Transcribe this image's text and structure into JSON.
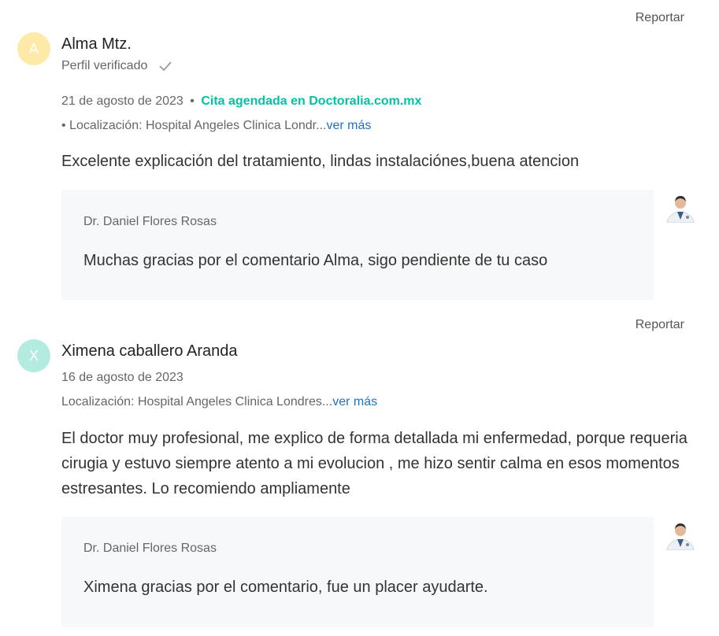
{
  "reviews": [
    {
      "report_label": "Reportar",
      "avatar_letter": "A",
      "name": "Alma Mtz.",
      "verified_label": "Perfil verificado",
      "date": "21 de agosto de 2023",
      "separator": "•",
      "booking_label": "Cita agendada en Doctoralia.com.mx",
      "location_prefix": "• Localización: Hospital Angeles Clinica Londr...",
      "more_label": "ver más",
      "text": "Excelente explicación del tratamiento, lindas instalaciónes,buena atencion",
      "reply": {
        "doctor": "Dr. Daniel Flores Rosas",
        "text": "Muchas gracias por el comentario Alma, sigo pendiente de tu caso"
      }
    },
    {
      "report_label": "Reportar",
      "avatar_letter": "X",
      "name": "Ximena caballero Aranda",
      "date": "16 de agosto de 2023",
      "location_prefix": "Localización: Hospital Angeles Clinica Londres...",
      "more_label": "ver más",
      "text": "El doctor muy profesional, me explico de forma detallada mi enfermedad, porque requeria cirugia y estuvo siempre atento a mi evolucion , me hizo sentir calma en esos momentos estresantes. Lo recomiendo ampliamente",
      "reply": {
        "doctor": "Dr. Daniel Flores Rosas",
        "text": "Ximena gracias por el comentario, fue un placer ayudarte."
      }
    }
  ],
  "icons": {
    "verified": "check-icon",
    "doctor": "doctor-photo-icon"
  },
  "colors": {
    "accent_green": "#00c3a5",
    "link_blue": "#1a73c8",
    "reply_bg": "#f7f8f9"
  }
}
